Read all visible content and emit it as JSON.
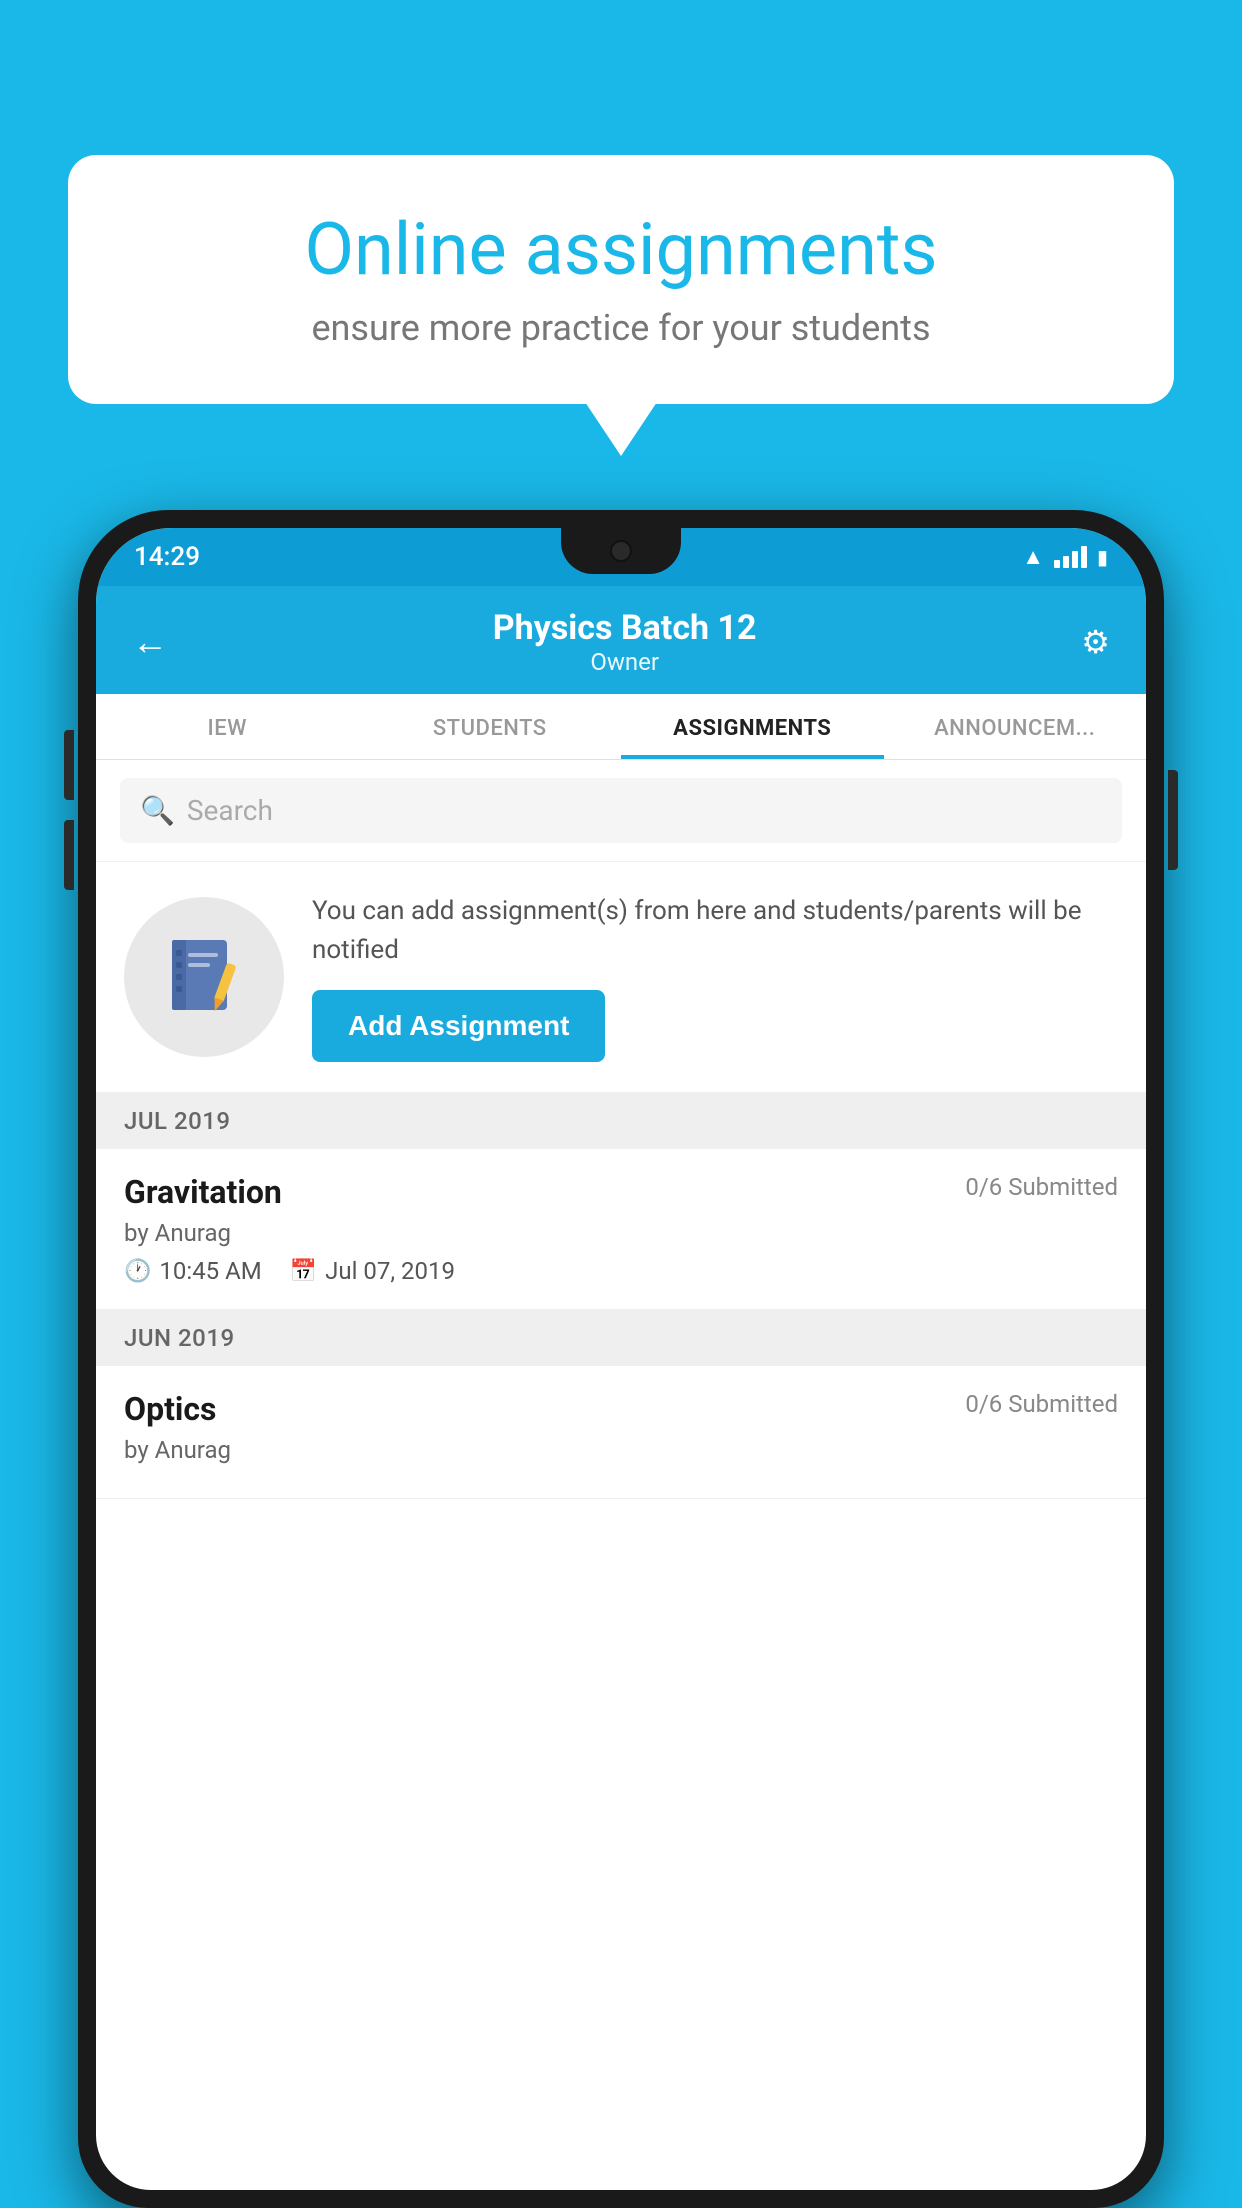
{
  "background_color": "#1ab8e8",
  "speech_bubble": {
    "title": "Online assignments",
    "subtitle": "ensure more practice for your students"
  },
  "status_bar": {
    "time": "14:29"
  },
  "header": {
    "title": "Physics Batch 12",
    "subtitle": "Owner",
    "back_label": "←",
    "settings_label": "⚙"
  },
  "tabs": [
    {
      "label": "IEW",
      "active": false
    },
    {
      "label": "STUDENTS",
      "active": false
    },
    {
      "label": "ASSIGNMENTS",
      "active": true
    },
    {
      "label": "ANNOUNCEM...",
      "active": false
    }
  ],
  "search": {
    "placeholder": "Search"
  },
  "promo": {
    "text": "You can add assignment(s) from here and students/parents will be notified",
    "button_label": "Add Assignment"
  },
  "sections": [
    {
      "month": "JUL 2019",
      "assignments": [
        {
          "name": "Gravitation",
          "submitted": "0/6 Submitted",
          "by": "by Anurag",
          "time": "10:45 AM",
          "date": "Jul 07, 2019"
        }
      ]
    },
    {
      "month": "JUN 2019",
      "assignments": [
        {
          "name": "Optics",
          "submitted": "0/6 Submitted",
          "by": "by Anurag",
          "time": "",
          "date": ""
        }
      ]
    }
  ]
}
